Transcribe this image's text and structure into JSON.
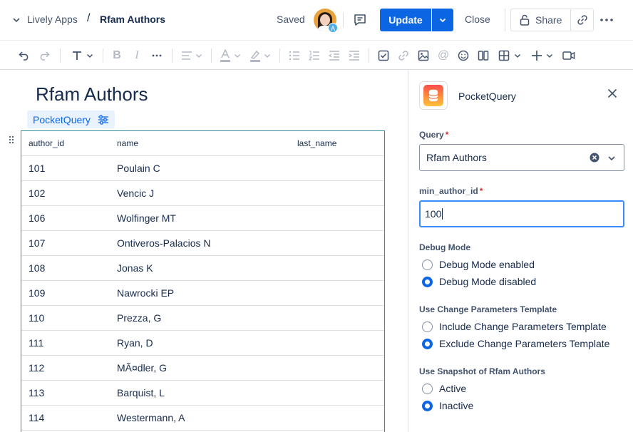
{
  "header": {
    "breadcrumb_space": "Lively Apps",
    "breadcrumb_sep": "/",
    "breadcrumb_page": "Rfam Authors",
    "saved_status": "Saved",
    "avatar_badge": "A",
    "update_label": "Update",
    "close_label": "Close",
    "share_label": "Share"
  },
  "toolbar": {
    "icons": [
      "undo-icon",
      "redo-icon",
      "text-style-icon",
      "bold-icon",
      "italic-icon",
      "more-formatting-icon",
      "align-icon",
      "text-color-icon",
      "highlight-icon",
      "bullet-list-icon",
      "numbered-list-icon",
      "outdent-icon",
      "indent-icon",
      "task-icon",
      "link-icon",
      "image-icon",
      "mention-icon",
      "emoji-icon",
      "layout-icon",
      "table-icon",
      "insert-icon",
      "video-icon"
    ]
  },
  "editor": {
    "title": "Rfam Authors",
    "macro_label": "PocketQuery",
    "table": {
      "headers": [
        "author_id",
        "name",
        "last_name"
      ],
      "rows": [
        [
          "101",
          "Poulain C",
          ""
        ],
        [
          "102",
          "Vencic J",
          ""
        ],
        [
          "106",
          "Wolfinger MT",
          ""
        ],
        [
          "107",
          "Ontiveros-Palacios N",
          ""
        ],
        [
          "108",
          "Jonas K",
          ""
        ],
        [
          "109",
          "Nawrocki EP",
          ""
        ],
        [
          "110",
          "Prezza, G",
          ""
        ],
        [
          "111",
          "Ryan, D",
          ""
        ],
        [
          "112",
          "MÃ¤dler, G",
          ""
        ],
        [
          "113",
          "Barquist, L",
          ""
        ],
        [
          "114",
          "Westermann, A",
          ""
        ]
      ]
    }
  },
  "panel": {
    "app_name": "PocketQuery",
    "query_label": "Query",
    "query_value": "Rfam Authors",
    "param_label": "min_author_id",
    "param_value": "100",
    "required_mark": "*",
    "debug_label": "Debug Mode",
    "debug_options": [
      "Debug Mode enabled",
      "Debug Mode disabled"
    ],
    "debug_selected": 1,
    "template_label": "Use Change Parameters Template",
    "template_options": [
      "Include Change Parameters Template",
      "Exclude Change Parameters Template"
    ],
    "template_selected": 1,
    "snapshot_label": "Use Snapshot of Rfam Authors",
    "snapshot_options": [
      "Active",
      "Inactive"
    ],
    "snapshot_selected": 1
  },
  "colors": {
    "primary": "#0c66e4",
    "table_border": "#2f8c9e",
    "text": "#172b4d",
    "required": "#c9372c"
  }
}
